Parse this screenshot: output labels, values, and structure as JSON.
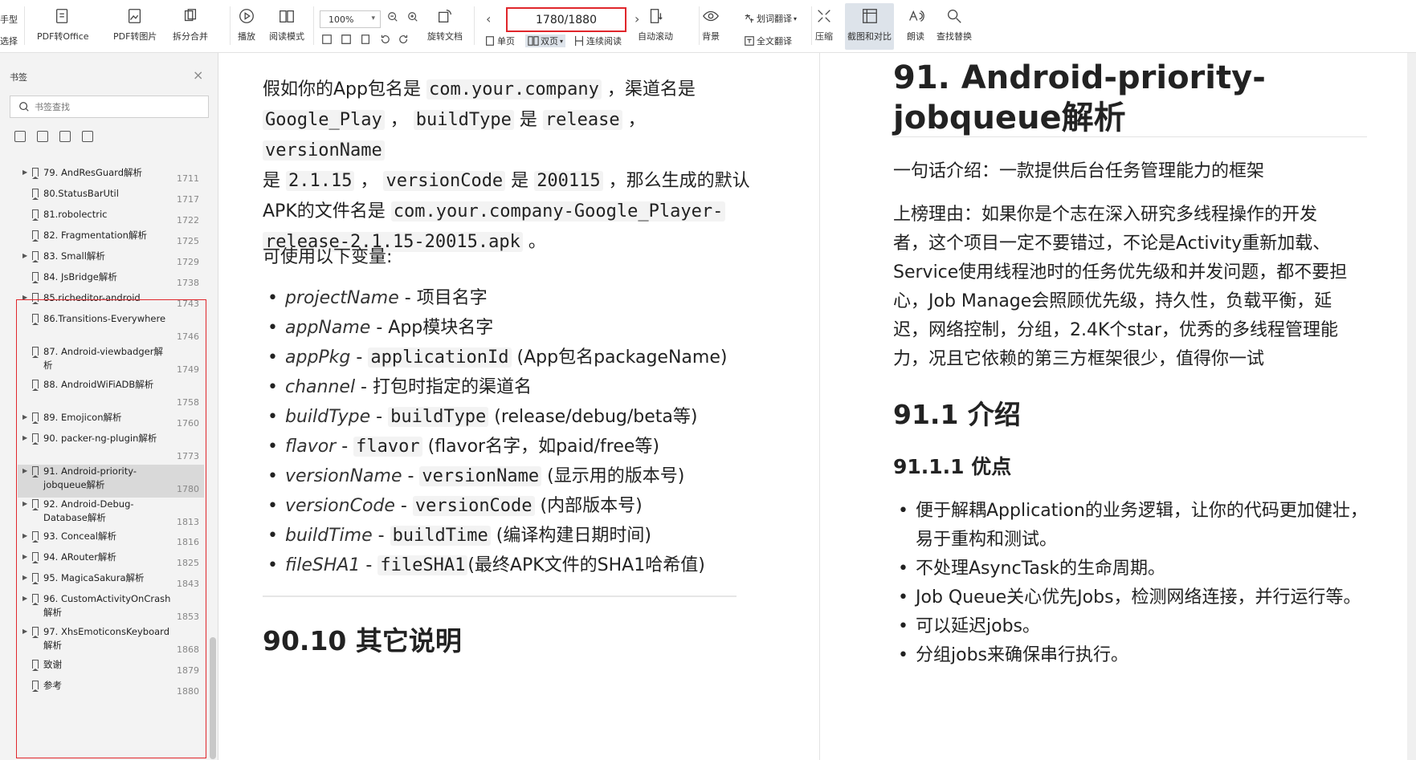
{
  "toolbar": {
    "left_cut_1": "手型",
    "left_cut_2": "选择",
    "pdf_to_office": "PDF转Office",
    "pdf_to_image": "PDF转图片",
    "split_merge": "拆分合并",
    "play": "播放",
    "read_mode": "阅读模式",
    "zoom": "100%",
    "rotate_doc": "旋转文档",
    "single_page": "单页",
    "double_page": "双页",
    "continuous_read": "连续阅读",
    "auto_scroll": "自动滚动",
    "background": "背景",
    "word_translate": "划词翻译",
    "full_translate": "全文翻译",
    "compress": "压缩",
    "screenshot_compare": "截图和对比",
    "read_aloud": "朗读",
    "find_replace": "查找替换",
    "page_indicator": "1780/1880"
  },
  "sidebar": {
    "title": "书签",
    "search_placeholder": "书签查找",
    "items": [
      {
        "label": "79. AndResGuard解析",
        "page": "1711",
        "expandable": true
      },
      {
        "label": "80.StatusBarUtil",
        "page": "1717",
        "expandable": false
      },
      {
        "label": "81.robolectric",
        "page": "1722",
        "expandable": false
      },
      {
        "label": "82. Fragmentation解析",
        "page": "1725",
        "expandable": false
      },
      {
        "label": "83. Small解析",
        "page": "1729",
        "expandable": true
      },
      {
        "label": "84. JsBridge解析",
        "page": "1738",
        "expandable": false
      },
      {
        "label": "85.richeditor-android",
        "page": "1743",
        "expandable": true
      },
      {
        "label": "86.Transitions-Everywhere",
        "page": "1746",
        "expandable": false
      },
      {
        "label": "87. Android-viewbadger解析",
        "page": "1749",
        "expandable": false
      },
      {
        "label": "88. AndroidWiFiADB解析",
        "page": "1758",
        "expandable": false
      },
      {
        "label": "89. Emojicon解析",
        "page": "1760",
        "expandable": true
      },
      {
        "label": "90. packer-ng-plugin解析",
        "page": "1773",
        "expandable": true
      },
      {
        "label": "91. Android-priority-jobqueue解析",
        "page": "1780",
        "expandable": true,
        "selected": true
      },
      {
        "label": "92. Android-Debug-Database解析",
        "page": "1813",
        "expandable": true
      },
      {
        "label": "93. Conceal解析",
        "page": "1816",
        "expandable": true
      },
      {
        "label": "94. ARouter解析",
        "page": "1825",
        "expandable": true
      },
      {
        "label": "95. MagicaSakura解析",
        "page": "1843",
        "expandable": true
      },
      {
        "label": "96. CustomActivityOnCrash解析",
        "page": "1853",
        "expandable": true
      },
      {
        "label": "97. XhsEmoticonsKeyboard解析",
        "page": "1868",
        "expandable": true
      },
      {
        "label": "致谢",
        "page": "1879",
        "expandable": false
      },
      {
        "label": "参考",
        "page": "1880",
        "expandable": false
      }
    ]
  },
  "left_page": {
    "para1": {
      "t1": "假如你的App包名是 ",
      "c1": "com.your.company",
      "t2": " ，渠道名是",
      "c2": "Google_Play",
      "t3": " ， ",
      "c3": "buildType",
      "t4": " 是 ",
      "c4": "release",
      "t5": " ， ",
      "c5": "versionName",
      "t6": "是 ",
      "c6": "2.1.15",
      "t7": " ， ",
      "c7": "versionCode",
      "t8": " 是 ",
      "c8": "200115",
      "t9": " ，那么生成的默认",
      "t10": "APK的文件名是 ",
      "c9": "com.your.company-Google_Player-",
      "c10": "release-2.1.15-20015.apk",
      "t11": " 。"
    },
    "vars_intro": "可使用以下变量:",
    "vars": [
      {
        "name": "projectName",
        "sep": " - ",
        "code": "",
        "desc": "项目名字"
      },
      {
        "name": "appName",
        "sep": " - ",
        "code": "",
        "desc": "App模块名字"
      },
      {
        "name": "appPkg",
        "sep": " - ",
        "code": "applicationId",
        "desc": " (App包名packageName)"
      },
      {
        "name": "channel",
        "sep": " - ",
        "code": "",
        "desc": "打包时指定的渠道名"
      },
      {
        "name": "buildType",
        "sep": " - ",
        "code": "buildType",
        "desc": " (release/debug/beta等)"
      },
      {
        "name": "flavor",
        "sep": " - ",
        "code": "flavor",
        "desc": " (flavor名字，如paid/free等)"
      },
      {
        "name": "versionName",
        "sep": " - ",
        "code": "versionName",
        "desc": " (显示用的版本号)"
      },
      {
        "name": "versionCode",
        "sep": " - ",
        "code": "versionCode",
        "desc": " (内部版本号)"
      },
      {
        "name": "buildTime",
        "sep": " - ",
        "code": "buildTime",
        "desc": " (编译构建日期时间)"
      },
      {
        "name": "fileSHA1",
        "sep": " - ",
        "code": "fileSHA1",
        "desc": "(最终APK文件的SHA1哈希值)"
      }
    ],
    "heading": "90.10 其它说明"
  },
  "right_page": {
    "h1_line1": "91. Android-priority-",
    "h1_line2": "jobqueue解析",
    "intro": "一句话介绍：一款提供后台任务管理能力的框架",
    "reason_lines": [
      "上榜理由：如果你是个志在深入研究多线程操作的开发",
      "者，这个项目一定不要错过，不论是Activity重新加载、",
      "Service使用线程池时的任务优先级和并发问题，都不要担",
      "心，Job Manage会照顾优先级，持久性，负载平衡，延",
      "迟，网络控制，分组，2.4K个star，优秀的多线程管理能",
      "力，况且它依赖的第三方框架很少，值得你一试"
    ],
    "h2": "91.1 介绍",
    "h3": "91.1.1 优点",
    "bullets": [
      "便于解耦Application的业务逻辑，让你的代码更加健壮，易于重构和测试。",
      "不处理AsyncTask的生命周期。",
      "Job Queue关心优先Jobs，检测网络连接，并行运行等。",
      "可以延迟jobs。",
      "分组jobs来确保串行执行。"
    ]
  },
  "colors": {
    "highlight_border": "#e0262b",
    "selected_row": "#d9d9d9"
  }
}
